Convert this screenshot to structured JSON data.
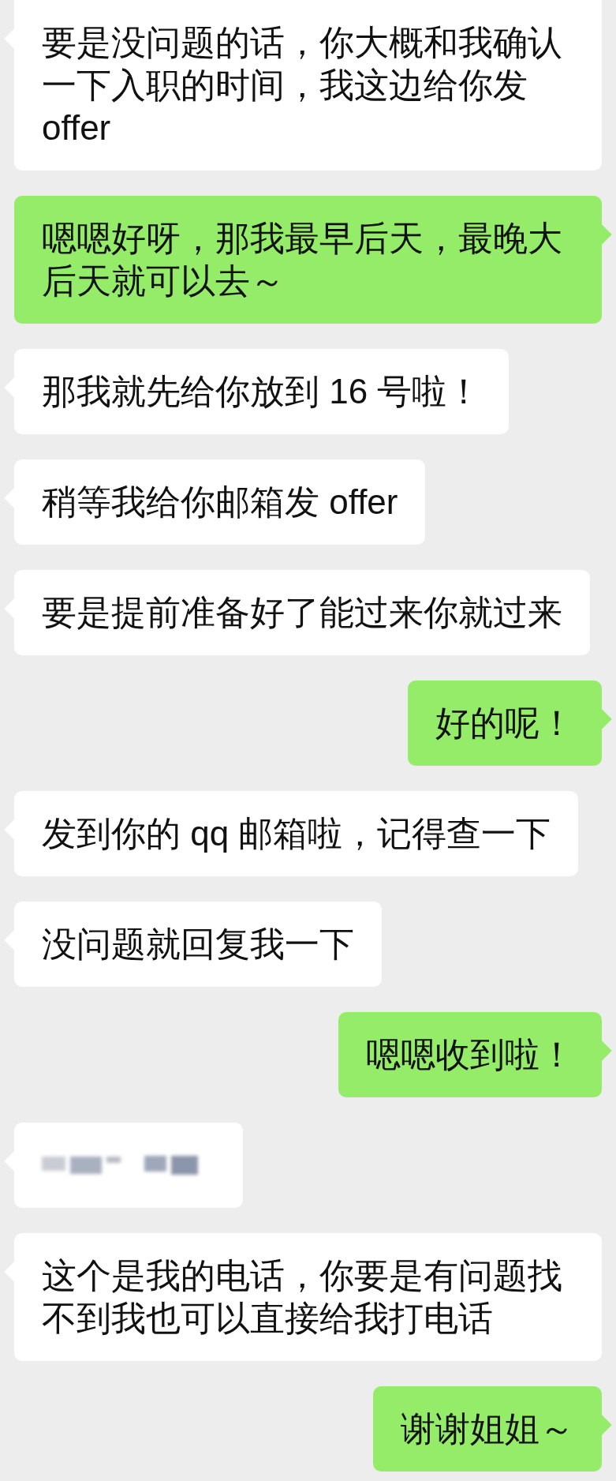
{
  "messages": [
    {
      "outgoing": false,
      "kind": "text",
      "text": "要是没问题的话，你大概和我确认一下入职的时间，我这边给你发offer"
    },
    {
      "outgoing": true,
      "kind": "text",
      "text": "嗯嗯好呀，那我最早后天，最晚大后天就可以去～"
    },
    {
      "outgoing": false,
      "kind": "text",
      "text": "那我就先给你放到 16 号啦！"
    },
    {
      "outgoing": false,
      "kind": "text",
      "text": "稍等我给你邮箱发 offer"
    },
    {
      "outgoing": false,
      "kind": "text",
      "text": "要是提前准备好了能过来你就过来"
    },
    {
      "outgoing": true,
      "kind": "text",
      "text": "好的呢！"
    },
    {
      "outgoing": false,
      "kind": "text",
      "text": "发到你的 qq 邮箱啦，记得查一下"
    },
    {
      "outgoing": false,
      "kind": "text",
      "text": "没问题就回复我一下"
    },
    {
      "outgoing": true,
      "kind": "text",
      "text": "嗯嗯收到啦！"
    },
    {
      "outgoing": false,
      "kind": "blurred"
    },
    {
      "outgoing": false,
      "kind": "text",
      "text": "这个是我的电话，你要是有问题找不到我也可以直接给我打电话"
    },
    {
      "outgoing": true,
      "kind": "text",
      "text": "谢谢姐姐～"
    }
  ]
}
